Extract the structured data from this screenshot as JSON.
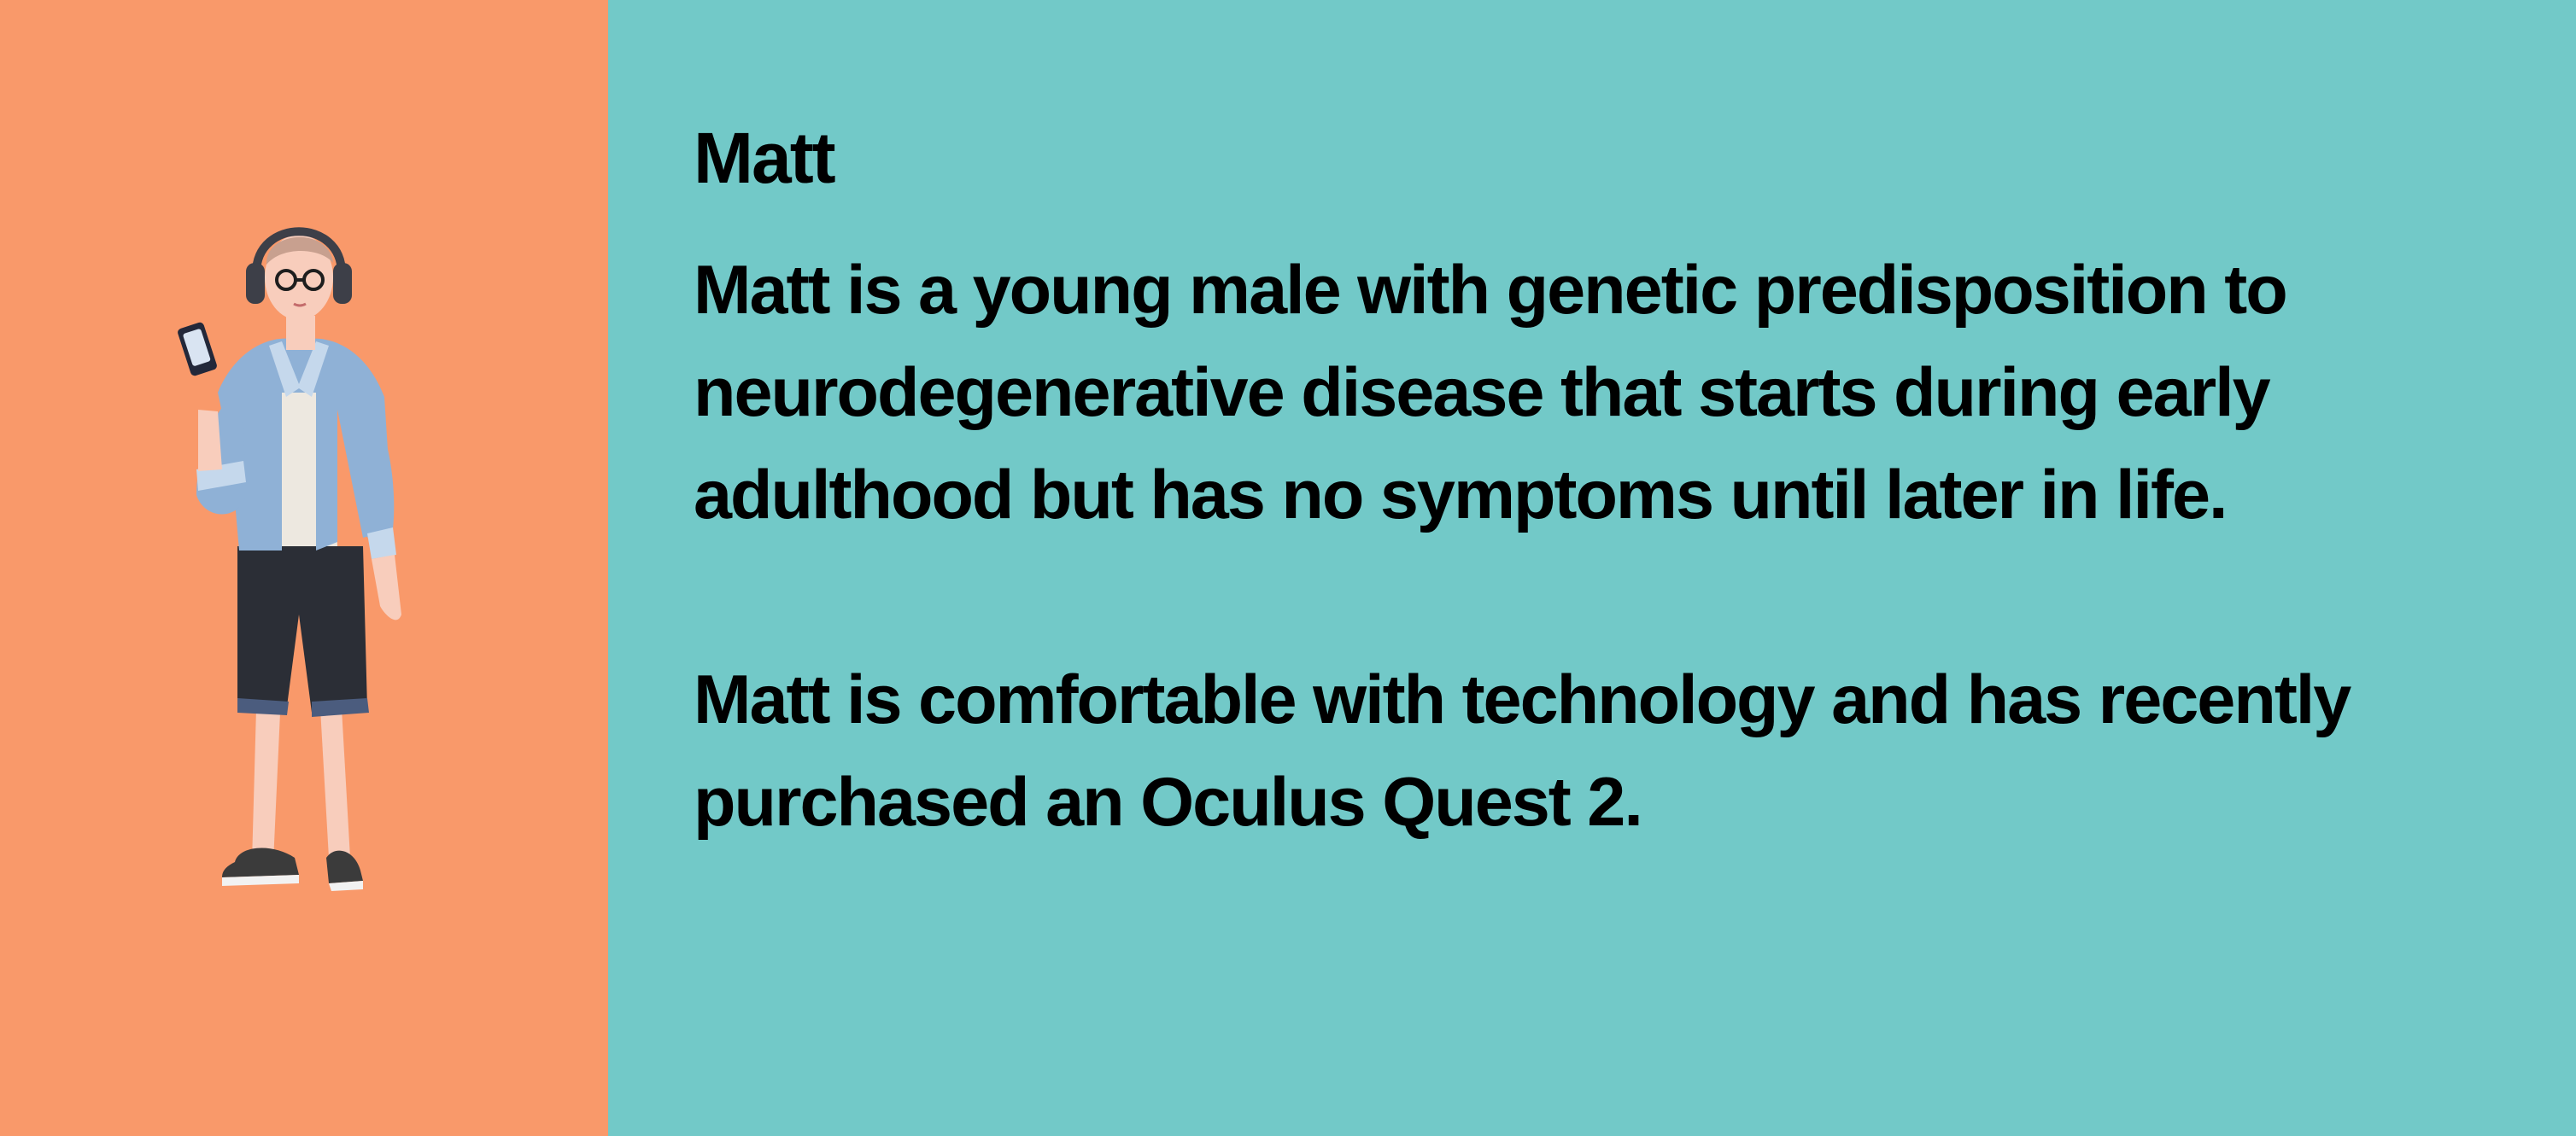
{
  "persona": {
    "name": "Matt",
    "paragraphs": [
      "Matt is a young male with genetic predisposition to neurodegenerative disease that starts during early adulthood but has no symptoms until later in life.",
      "Matt is comfortable with technology and has recently purchased an Oculus Quest 2."
    ]
  },
  "colors": {
    "left_panel": "#F9996A",
    "right_panel": "#72C9C8",
    "text": "#000000"
  },
  "illustration": "young-man-with-headphones-and-phone"
}
